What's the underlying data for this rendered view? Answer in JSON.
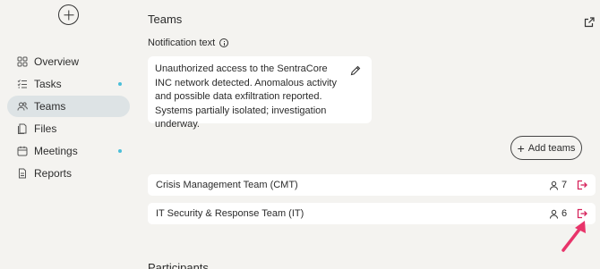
{
  "sidebar": {
    "items": [
      {
        "label": "Overview",
        "icon": "grid-icon",
        "active": false,
        "dot": false
      },
      {
        "label": "Tasks",
        "icon": "checklist-icon",
        "active": false,
        "dot": true
      },
      {
        "label": "Teams",
        "icon": "people-icon",
        "active": true,
        "dot": false
      },
      {
        "label": "Files",
        "icon": "files-icon",
        "active": false,
        "dot": false
      },
      {
        "label": "Meetings",
        "icon": "calendar-icon",
        "active": false,
        "dot": true
      },
      {
        "label": "Reports",
        "icon": "document-icon",
        "active": false,
        "dot": false
      }
    ],
    "dot_color": "#4bbfd9"
  },
  "main": {
    "title": "Teams",
    "notification_label": "Notification text",
    "notification_text": "Unauthorized access to the SentraCore INC network detected. Anomalous activity and possible data exfiltration reported. Systems partially isolated; investigation underway.",
    "add_teams_label": "Add teams",
    "teams": [
      {
        "name": "Crisis Management Team (CMT)",
        "members": "7"
      },
      {
        "name": "IT Security & Response Team (IT)",
        "members": "6"
      }
    ],
    "participants_heading": "Participants"
  },
  "colors": {
    "accent_leave": "#d6245c",
    "background": "#f4f3f0",
    "active_nav": "#dde3e5"
  }
}
